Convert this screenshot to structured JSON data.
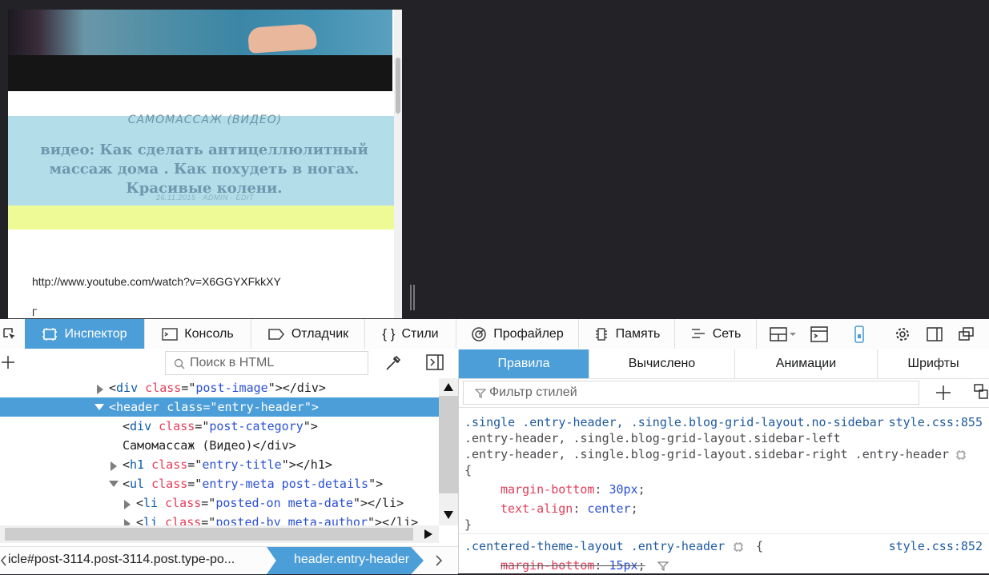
{
  "preview": {
    "category": "САМОМАССАЖ (ВИДЕО)",
    "title": "видео: Как сделать антицеллюлитный массаж дома . Как похудеть в ногах. Красивые колени.",
    "meta": "26.11.2015 · ADMIN · EDIT",
    "link": "http://www.youtube.com/watch?v=X6GGYXFkkXY",
    "next_char": "Г"
  },
  "toolbar": {
    "tabs": [
      "Инспектор",
      "Консоль",
      "Отладчик",
      "Стили",
      "Профайлер",
      "Память",
      "Сеть"
    ],
    "icons": [
      "inspector-icon",
      "console-icon",
      "debugger-icon",
      "styles-icon",
      "profiler-icon",
      "memory-icon",
      "network-icon"
    ],
    "accent": "#4c9ed9"
  },
  "markup": {
    "search_placeholder": "Поиск в HTML",
    "rows": [
      {
        "tag": "div",
        "attr": "class",
        "val": "post-image",
        "after": "></div>"
      },
      {
        "tag": "header",
        "attr": "class",
        "val": "entry-header",
        "after": ">"
      },
      {
        "tag": "div",
        "attr": "class",
        "val": "post-category",
        "after": ">"
      },
      {
        "text": "Самомассаж (Видео)</div>"
      },
      {
        "tag": "h1",
        "attr": "class",
        "val": "entry-title",
        "after": "></h1>"
      },
      {
        "tag": "ul",
        "attr": "class",
        "val": "entry-meta post-details",
        "after": ">"
      },
      {
        "tag": "li",
        "attr": "class",
        "val": "posted-on meta-date",
        "after": "></li>"
      },
      {
        "tag": "li",
        "attr": "class",
        "val": "posted-by meta-author",
        "after": "></li>"
      }
    ],
    "breadcrumbs": [
      "icle#post-3114.post-3114.post.type-po...",
      "header.entry-header"
    ]
  },
  "rules_panel": {
    "tabs": [
      "Правила",
      "Вычислено",
      "Анимации",
      "Шрифты"
    ],
    "filter_placeholder": "Фильтр стилей",
    "rule1": {
      "selector_lines": [
        ".single .entry-header, .single.blog-grid-layout.no-sidebar",
        ".entry-header, .single.blog-grid-layout.sidebar-left",
        ".entry-header, .single.blog-grid-layout.sidebar-right .entry-header"
      ],
      "source": "style.css:855",
      "open": "{",
      "close": "}",
      "decls": [
        {
          "prop": "margin-bottom",
          "value": "30px"
        },
        {
          "prop": "text-align",
          "value": "center"
        }
      ]
    },
    "rule2": {
      "selector": ".centered-theme-layout .entry-header",
      "open": "{",
      "source": "style.css:852",
      "decls": [
        {
          "prop": "margin-bottom",
          "value": "15px"
        }
      ]
    }
  }
}
